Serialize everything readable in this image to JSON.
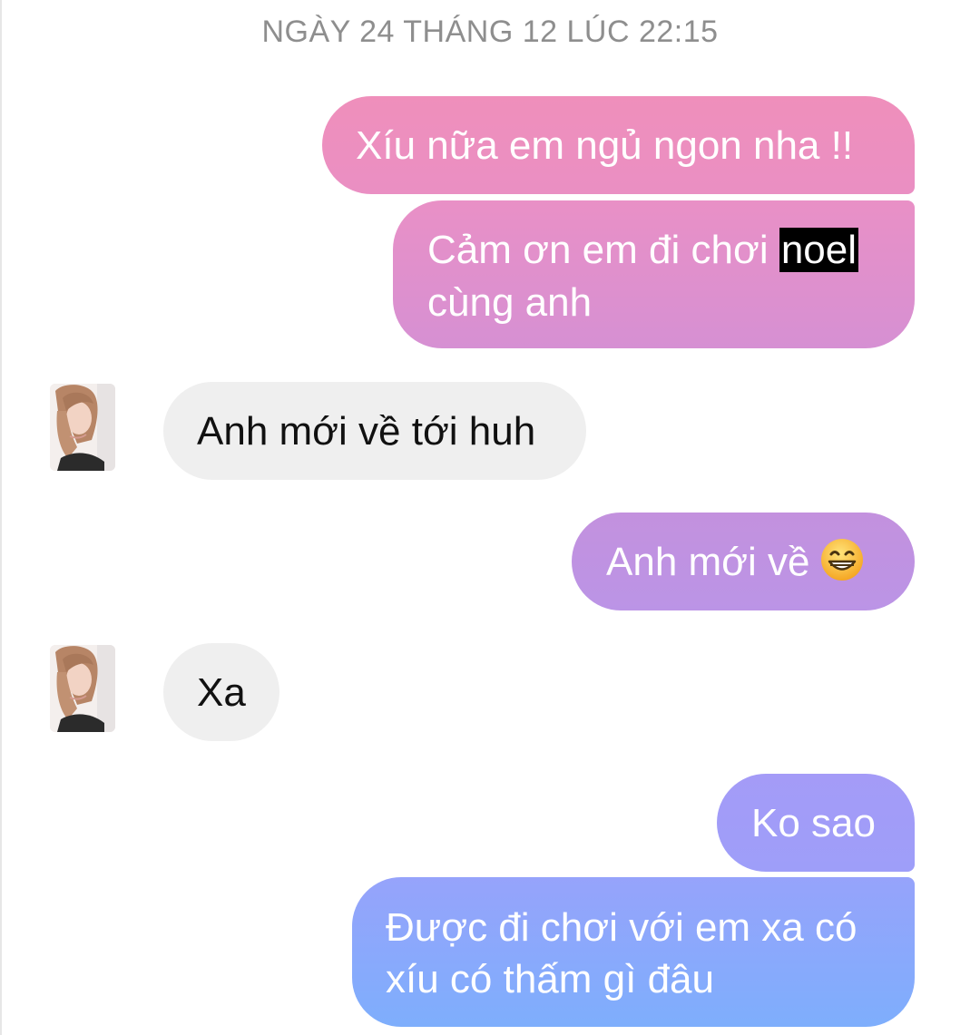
{
  "conversation": {
    "timestamp": "NGÀY 24 THÁNG 12 LÚC 22:15",
    "messages": [
      {
        "sender": "me",
        "text": "Xíu nữa em ngủ ngon nha !!"
      },
      {
        "sender": "me",
        "text_before": "Cảm ơn em đi chơi ",
        "highlight": "noel",
        "text_after": " cùng anh"
      },
      {
        "sender": "them",
        "text": "Anh mới về tới huh"
      },
      {
        "sender": "me",
        "text": "Anh mới về",
        "emoji": "grinning-face-emoji"
      },
      {
        "sender": "them",
        "text": "Xa"
      },
      {
        "sender": "me",
        "text": "Ko sao"
      },
      {
        "sender": "me",
        "text": "Được đi chơi với em xa có xíu có thấm gì đâu"
      }
    ]
  },
  "colors": {
    "outgoing_top": "#ef8fbb",
    "outgoing_bottom": "#7eaefc",
    "incoming": "#efefef",
    "timestamp": "#8e8e8e"
  },
  "icons": {
    "avatar": "contact-avatar",
    "emoji": "grinning-face-emoji"
  }
}
